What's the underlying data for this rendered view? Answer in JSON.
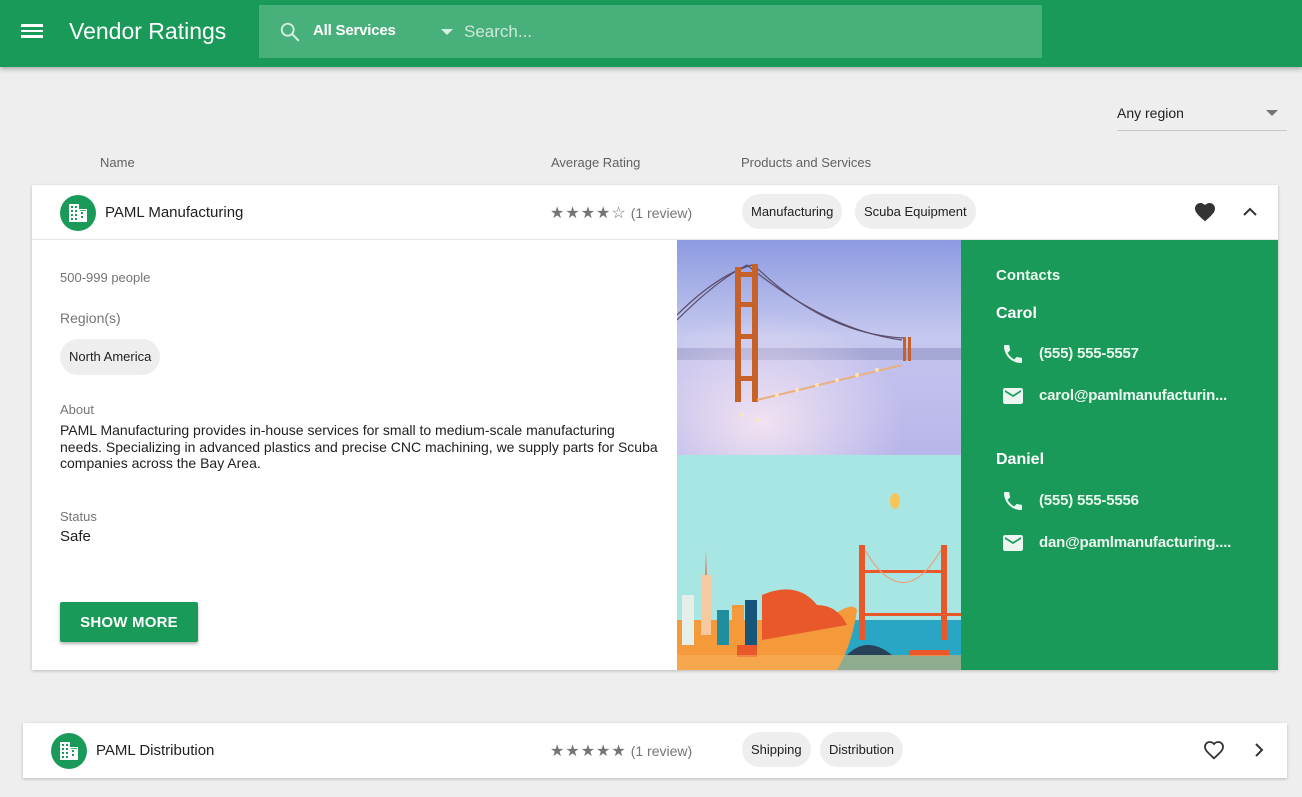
{
  "appbar": {
    "title": "Vendor Ratings",
    "menu_icon": "menu-icon",
    "search_icon": "search-icon",
    "service_filter": "All Services",
    "search_placeholder": "Search...",
    "search_value": ""
  },
  "filters": {
    "region": "Any region"
  },
  "columns": {
    "name": "Name",
    "rating": "Average Rating",
    "products": "Products and Services"
  },
  "colors": {
    "brand": "#1a9a58",
    "search_bg": "#48b07b",
    "chip_bg": "#eeeeee"
  },
  "vendors": [
    {
      "name": "PAML Manufacturing",
      "rating": 4,
      "max_rating": 5,
      "stars": "★★★★☆",
      "reviews": "(1 review)",
      "services": [
        "Manufacturing",
        "Scuba Equipment"
      ],
      "favorited": true,
      "expanded": true,
      "size": "500-999 people",
      "regions_label": "Region(s)",
      "regions": [
        "North America"
      ],
      "about_label": "About",
      "about": "PAML Manufacturing provides in-house services for small to medium-scale manufacturing needs. Specializing in advanced plastics and precise CNC machining, we supply parts for Scuba companies across the Bay Area.",
      "status_label": "Status",
      "status": "Safe",
      "show_more": "SHOW MORE",
      "contacts_label": "Contacts",
      "contacts": [
        {
          "name": "Carol",
          "phone": "(555) 555-5557",
          "email": "carol@pamlmanufacturin..."
        },
        {
          "name": "Daniel",
          "phone": "(555) 555-5556",
          "email": "dan@pamlmanufacturing...."
        }
      ]
    },
    {
      "name": "PAML Distribution",
      "rating": 5,
      "max_rating": 5,
      "stars": "★★★★★",
      "reviews": "(1 review)",
      "services": [
        "Shipping",
        "Distribution"
      ],
      "favorited": false,
      "expanded": false
    }
  ]
}
